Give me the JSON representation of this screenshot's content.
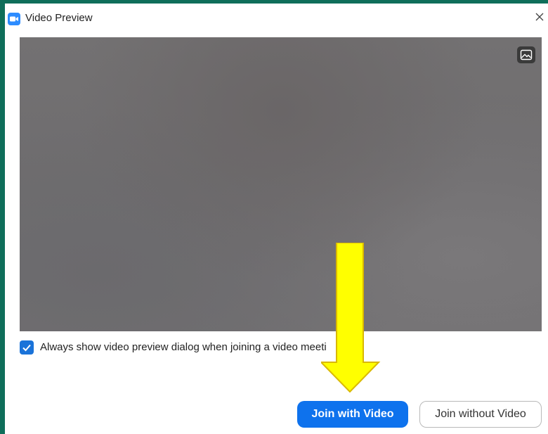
{
  "window": {
    "title": "Video Preview",
    "close_symbol": "×"
  },
  "preview": {
    "background_button_icon": "image-icon"
  },
  "options": {
    "always_show_label": "Always show video preview dialog when joining a video meeti",
    "always_show_checked": true
  },
  "actions": {
    "join_with_video": "Join with Video",
    "join_without_video": "Join without Video"
  },
  "annotation": {
    "arrow_color": "#ffff00",
    "arrow_outline": "#d9b800"
  },
  "colors": {
    "primary": "#0e72ed",
    "checkbox": "#1a73d9",
    "frame": "#0f6e5a"
  }
}
